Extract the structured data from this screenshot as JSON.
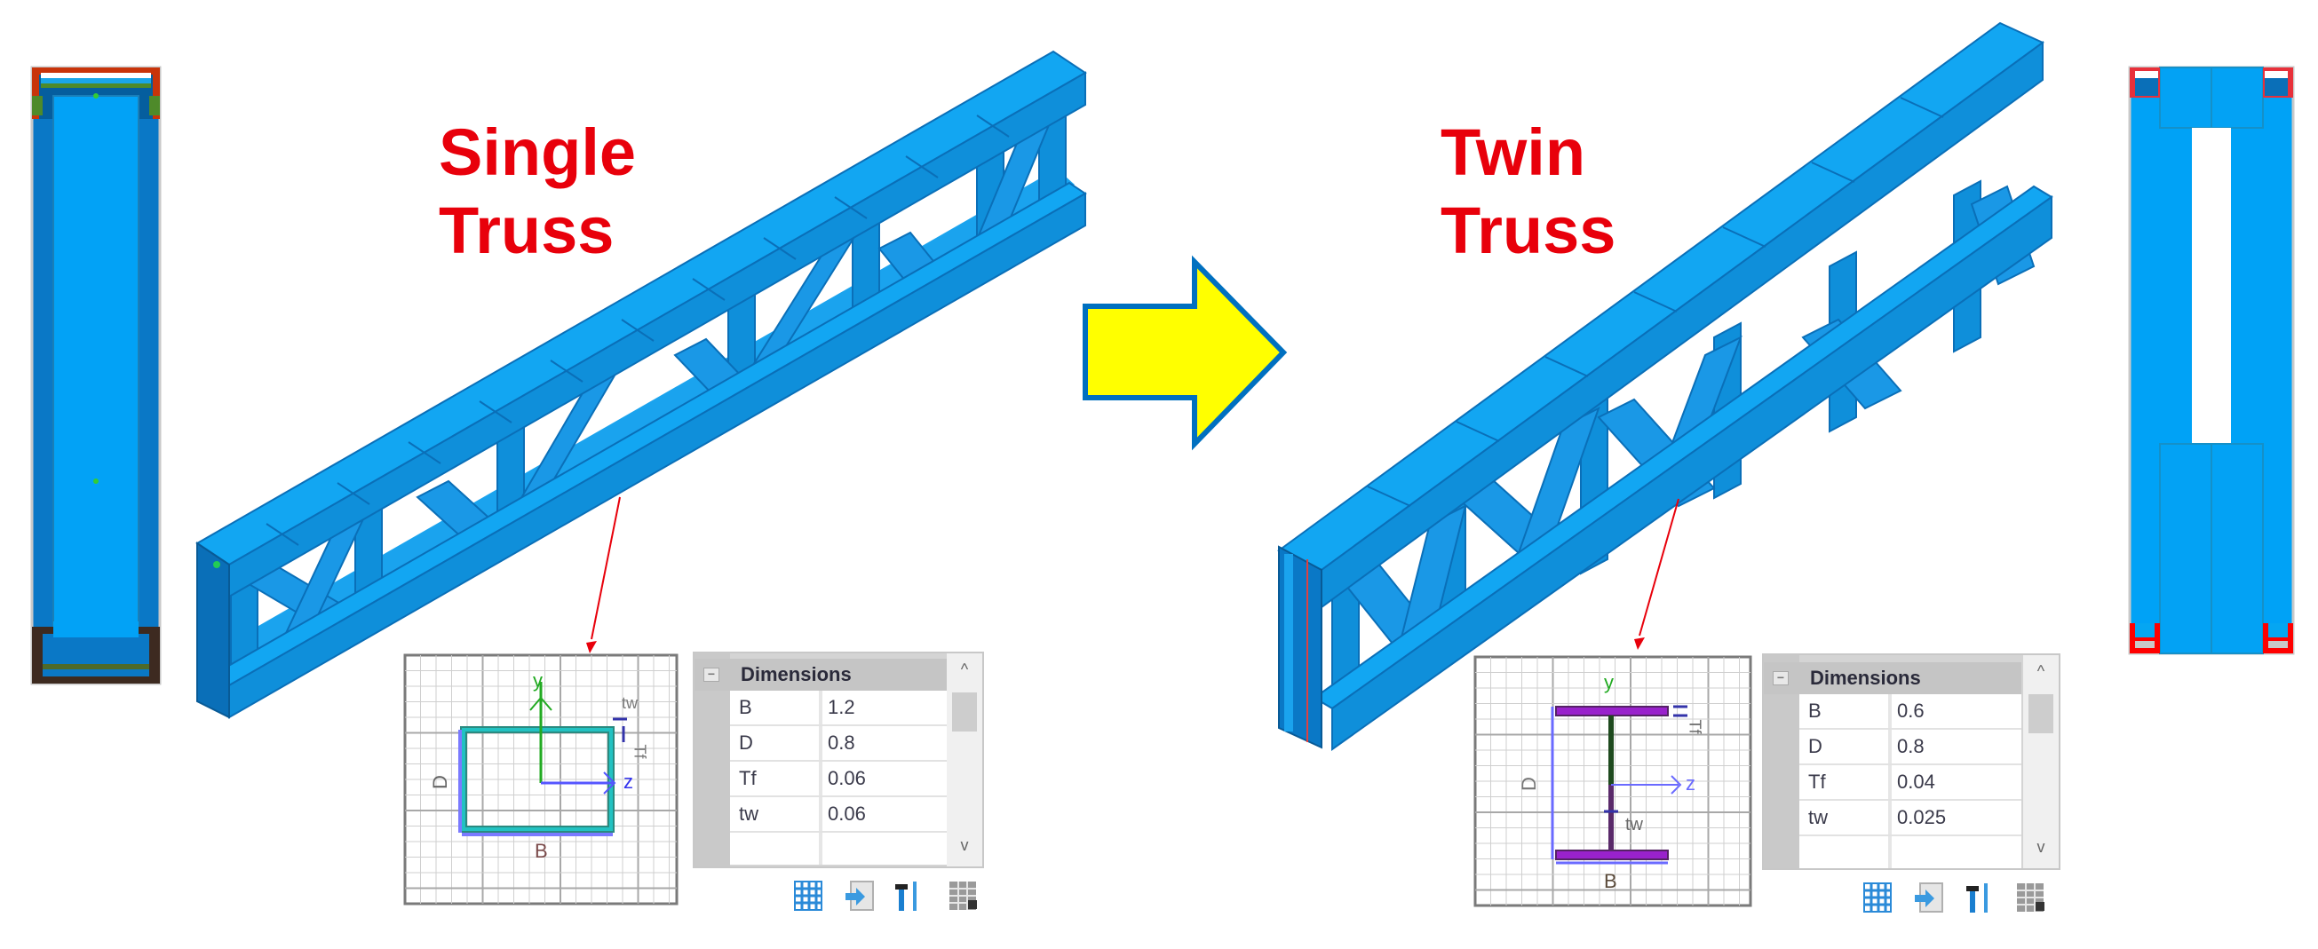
{
  "left": {
    "title_line1": "Single",
    "title_line2": "Truss",
    "section": {
      "type": "box",
      "labels": {
        "y": "y",
        "z": "z",
        "d": "D",
        "b": "B",
        "tw": "tw",
        "tf": "Tf"
      }
    },
    "dimensions": {
      "header": "Dimensions",
      "rows": [
        {
          "key": "B",
          "value": "1.2"
        },
        {
          "key": "D",
          "value": "0.8"
        },
        {
          "key": "Tf",
          "value": "0.06"
        },
        {
          "key": "tw",
          "value": "0.06"
        }
      ]
    }
  },
  "right": {
    "title_line1": "Twin",
    "title_line2": "Truss",
    "section": {
      "type": "i-beam",
      "labels": {
        "y": "y",
        "z": "z",
        "d": "D",
        "b": "B",
        "tw": "tw",
        "tf": "Tf"
      }
    },
    "dimensions": {
      "header": "Dimensions",
      "rows": [
        {
          "key": "B",
          "value": "0.6"
        },
        {
          "key": "D",
          "value": "0.8"
        },
        {
          "key": "Tf",
          "value": "0.04"
        },
        {
          "key": "tw",
          "value": "0.025"
        }
      ]
    }
  },
  "toolbar_icons": [
    "grid-icon",
    "import-icon",
    "section-tool-icon",
    "table-edit-icon"
  ],
  "scroll_glyphs": {
    "up": "^",
    "down": "v",
    "collapse": "−"
  },
  "colors": {
    "title": "#e8000b",
    "steel_light": "#1aa3ee",
    "steel_mid": "#0f8fda",
    "steel_dark": "#0a6fb8",
    "arrow_fill": "#ffff00",
    "arrow_stroke": "#0070c0",
    "leader": "#e8000b"
  }
}
